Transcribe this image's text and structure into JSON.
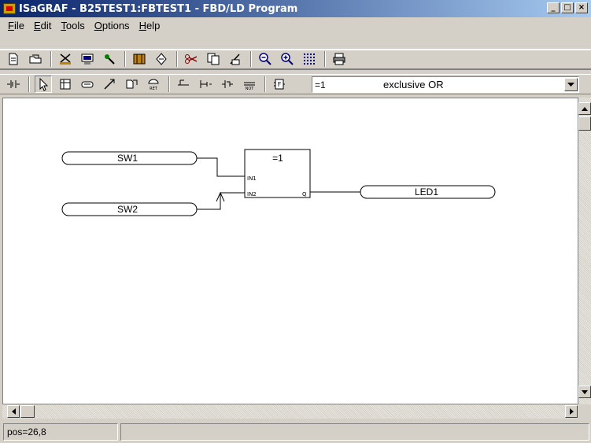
{
  "window": {
    "title": "ISaGRAF - B25TEST1:FBTEST1 - FBD/LD Program"
  },
  "title_buttons": {
    "minimize": "_",
    "maximize": "□",
    "close": "×"
  },
  "menu": [
    {
      "label": "File",
      "u": "F",
      "rest": "ile"
    },
    {
      "label": "Edit",
      "u": "E",
      "rest": "dit"
    },
    {
      "label": "Tools",
      "u": "T",
      "rest": "ools"
    },
    {
      "label": "Options",
      "u": "O",
      "rest": "ptions"
    },
    {
      "label": "Help",
      "u": "H",
      "rest": "elp"
    }
  ],
  "function_selector": {
    "name": "=1",
    "description": "exclusive OR"
  },
  "diagram": {
    "block": {
      "title": "=1",
      "in1": "IN1",
      "in2": "IN2",
      "out": "Q"
    },
    "inputs": [
      "SW1",
      "SW2"
    ],
    "output": "LED1"
  },
  "status": {
    "position": "pos=26,8"
  }
}
